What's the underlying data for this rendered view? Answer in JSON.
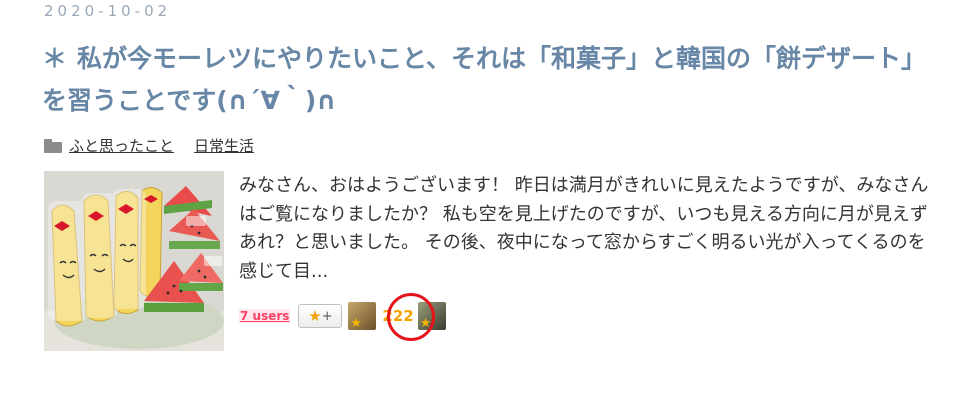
{
  "post": {
    "date": "2020-10-02",
    "title_icon": "＊",
    "title": "私が今モーレツにやりたいこと、それは「和菓子」と韓国の「餅デザート」を習うことです(∩´∀｀)∩",
    "categories": [
      "ふと思ったこと",
      "日常生活"
    ],
    "excerpt": "みなさん、おはようございます！ 昨日は満月がきれいに見えたようですが、みなさんはご覧になりましたか？ 私も空を見上げたのですが、いつも見える方向に月が見えずあれ？と思いました。 その後、夜中になって窓からすごく明るい光が入ってくるのを感じて目...",
    "thumbnail_icon": "banana-and-watermelon-rice-cake-photo"
  },
  "hatebu": {
    "users_label": "7 users",
    "star_add_star": "★",
    "star_add_plus": "+",
    "star_count": "222",
    "avatar_star": "★"
  },
  "colors": {
    "title": "#6887a6",
    "date": "#9aa9b8",
    "users": "#ff4166",
    "star": "#f5a300",
    "highlight": "#e4141b"
  }
}
